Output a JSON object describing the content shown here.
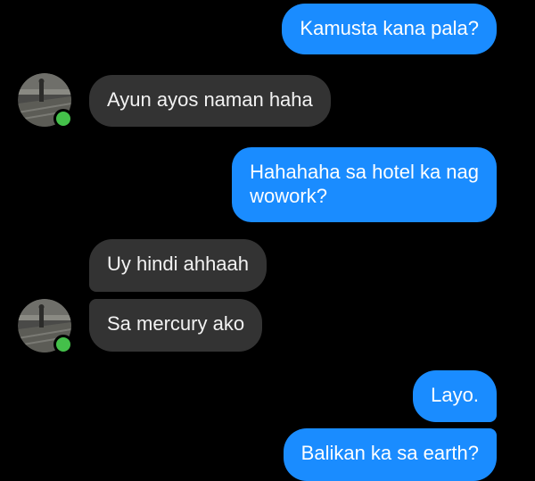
{
  "colors": {
    "background": "#000000",
    "outgoing_bubble": "#1a8cff",
    "incoming_bubble": "#333333",
    "presence_active": "#44c04a"
  },
  "icons": {
    "avatar": "contact-avatar-photo",
    "presence": "active-status-dot-icon"
  },
  "messages": [
    {
      "side": "outgoing",
      "text": "Kamusta kana pala?"
    },
    {
      "side": "incoming",
      "text": "Ayun ayos naman haha"
    },
    {
      "side": "outgoing",
      "lines": [
        "Hahahaha sa hotel ka nag",
        "wowork?"
      ]
    },
    {
      "side": "incoming",
      "text": "Uy hindi ahhaah"
    },
    {
      "side": "incoming",
      "text": "Sa mercury ako"
    },
    {
      "side": "outgoing",
      "text": "Layo."
    },
    {
      "side": "outgoing",
      "text": "Balikan ka sa earth?"
    }
  ]
}
